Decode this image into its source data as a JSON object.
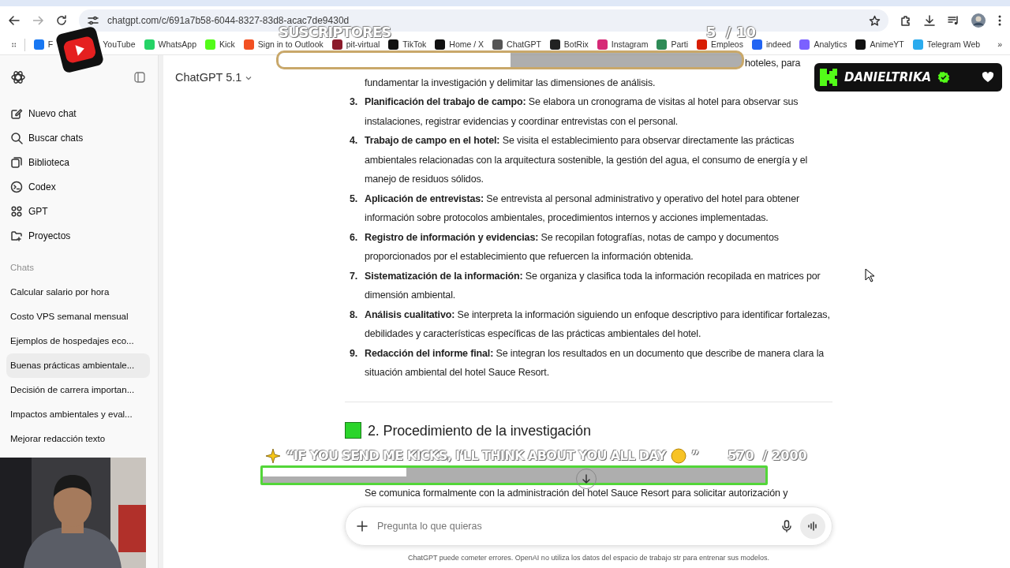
{
  "browser": {
    "url": "chatgpt.com/c/691a7b58-6044-8327-83d8-acac7de9430d",
    "bookmarks": [
      {
        "label": "F",
        "color": "#1877f2"
      },
      {
        "label": "YouTube"
      },
      {
        "label": "WhatsApp",
        "color": "#25d366"
      },
      {
        "label": "Kick",
        "color": "#53fc18"
      },
      {
        "label": "Sign in to Outlook",
        "color": "#f25022"
      },
      {
        "label": "pit-virtual",
        "color": "#8b1a2b"
      },
      {
        "label": "TikTok",
        "color": "#111111"
      },
      {
        "label": "Home / X",
        "color": "#111111"
      },
      {
        "label": "ChatGPT",
        "color": "#555555"
      },
      {
        "label": "BotRix",
        "color": "#222222"
      },
      {
        "label": "Instagram",
        "color": "#d62976"
      },
      {
        "label": "Parti",
        "color": "#2e8b57"
      },
      {
        "label": "Empleos",
        "color": "#d81e05"
      },
      {
        "label": "indeed",
        "color": "#2164f3"
      },
      {
        "label": "Analytics",
        "color": "#7b61ff"
      },
      {
        "label": "AnimeYT",
        "color": "#111111"
      },
      {
        "label": "Telegram Web",
        "color": "#2aabee"
      }
    ],
    "more": "»"
  },
  "sidebar": {
    "items": [
      {
        "label": "Nuevo chat"
      },
      {
        "label": "Buscar chats"
      },
      {
        "label": "Biblioteca"
      },
      {
        "label": "Codex"
      },
      {
        "label": "GPT"
      },
      {
        "label": "Proyectos"
      }
    ],
    "section": "Chats",
    "chats": [
      {
        "label": "Calcular salario por hora",
        "selected": false
      },
      {
        "label": "Costo VPS semanal mensual",
        "selected": false
      },
      {
        "label": "Ejemplos de hospedajes eco...",
        "selected": false
      },
      {
        "label": "Buenas prácticas ambientale...",
        "selected": true
      },
      {
        "label": "Decisión de carrera importan...",
        "selected": false
      },
      {
        "label": "Impactos ambientales y eval...",
        "selected": false
      },
      {
        "label": "Mejorar redacción texto",
        "selected": false
      }
    ]
  },
  "header": {
    "model": "ChatGPT 5.1"
  },
  "content": {
    "continuation": [
      "hoteles, para",
      "fundamentar la investigación y delimitar las dimensiones de análisis."
    ],
    "steps": [
      {
        "number": "3.",
        "text": "**Planificación del trabajo de campo:** Se elabora un cronograma de visitas al hotel para observar sus instalaciones, registrar evidencias y coordinar entrevistas con el personal."
      },
      {
        "number": "4.",
        "text": "**Trabajo de campo en el hotel:** Se visita el establecimiento para observar directamente las prácticas ambientales relacionadas con la arquitectura sostenible, la gestión del agua, el consumo de energía y el manejo de residuos sólidos."
      },
      {
        "number": "5.",
        "text": "**Aplicación de entrevistas:** Se entrevista al personal administrativo y operativo del hotel para obtener información sobre protocolos ambientales, procedimientos internos y acciones implementadas."
      },
      {
        "number": "6.",
        "text": "**Registro de información y evidencias:** Se recopilan fotografías, notas de campo y documentos proporcionados por el establecimiento que refuercen la información obtenida."
      },
      {
        "number": "7.",
        "text": "**Sistematización de la información:** Se organiza y clasifica toda la información recopilada en matrices por dimensión ambiental."
      },
      {
        "number": "8.",
        "text": "**Análisis cualitativo:** Se interpreta la información siguiendo un enfoque descriptivo para identificar fortalezas, debilidades y características específicas de las prácticas ambientales del hotel."
      },
      {
        "number": "9.",
        "text": "**Redacción del informe final:** Se integran los resultados en un documento que describe de manera clara la situación ambiental del hotel Sauce Resort."
      }
    ],
    "heading": "2. Procedimiento de la investigación",
    "paragraph": "Se comunica formalmente con la administración del hotel Sauce Resort para solicitar autorización y"
  },
  "composer": {
    "placeholder": "Pregunta lo que quieras"
  },
  "disclaimer": "ChatGPT puede cometer errores. OpenAI no utiliza los datos del espacio de trabajo str para entrenar sus modelos.",
  "overlays": {
    "subscriber_goal": {
      "label": "SUSCRIPTORES",
      "count": "5",
      "target": "/ 10",
      "level": 0.5
    },
    "kick_goal": {
      "message": "“IF YOU SEND ME KICKS, I'LL THINK ABOUT YOU ALL DAY",
      "closing": "”",
      "count": "570",
      "target": "/ 2000",
      "level": 0.285
    },
    "kick_badge": {
      "username": "DANIELTRIKA"
    }
  }
}
